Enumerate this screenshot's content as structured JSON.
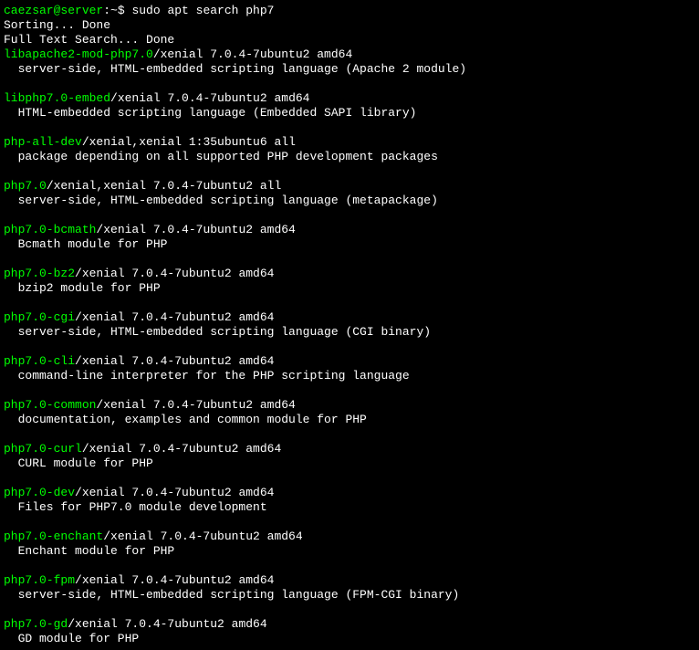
{
  "prompt": {
    "user_host": "caezsar@server",
    "path": ":~$",
    "command": "sudo apt search php7"
  },
  "status_lines": [
    "Sorting... Done",
    "Full Text Search... Done"
  ],
  "packages": [
    {
      "name": "libapache2-mod-php7.0",
      "meta": "/xenial 7.0.4-7ubuntu2 amd64",
      "desc": "server-side, HTML-embedded scripting language (Apache 2 module)"
    },
    {
      "name": "libphp7.0-embed",
      "meta": "/xenial 7.0.4-7ubuntu2 amd64",
      "desc": "HTML-embedded scripting language (Embedded SAPI library)"
    },
    {
      "name": "php-all-dev",
      "meta": "/xenial,xenial 1:35ubuntu6 all",
      "desc": "package depending on all supported PHP development packages"
    },
    {
      "name": "php7.0",
      "meta": "/xenial,xenial 7.0.4-7ubuntu2 all",
      "desc": "server-side, HTML-embedded scripting language (metapackage)"
    },
    {
      "name": "php7.0-bcmath",
      "meta": "/xenial 7.0.4-7ubuntu2 amd64",
      "desc": "Bcmath module for PHP"
    },
    {
      "name": "php7.0-bz2",
      "meta": "/xenial 7.0.4-7ubuntu2 amd64",
      "desc": "bzip2 module for PHP"
    },
    {
      "name": "php7.0-cgi",
      "meta": "/xenial 7.0.4-7ubuntu2 amd64",
      "desc": "server-side, HTML-embedded scripting language (CGI binary)"
    },
    {
      "name": "php7.0-cli",
      "meta": "/xenial 7.0.4-7ubuntu2 amd64",
      "desc": "command-line interpreter for the PHP scripting language"
    },
    {
      "name": "php7.0-common",
      "meta": "/xenial 7.0.4-7ubuntu2 amd64",
      "desc": "documentation, examples and common module for PHP"
    },
    {
      "name": "php7.0-curl",
      "meta": "/xenial 7.0.4-7ubuntu2 amd64",
      "desc": "CURL module for PHP"
    },
    {
      "name": "php7.0-dev",
      "meta": "/xenial 7.0.4-7ubuntu2 amd64",
      "desc": "Files for PHP7.0 module development"
    },
    {
      "name": "php7.0-enchant",
      "meta": "/xenial 7.0.4-7ubuntu2 amd64",
      "desc": "Enchant module for PHP"
    },
    {
      "name": "php7.0-fpm",
      "meta": "/xenial 7.0.4-7ubuntu2 amd64",
      "desc": "server-side, HTML-embedded scripting language (FPM-CGI binary)"
    },
    {
      "name": "php7.0-gd",
      "meta": "/xenial 7.0.4-7ubuntu2 amd64",
      "desc": "GD module for PHP"
    }
  ]
}
